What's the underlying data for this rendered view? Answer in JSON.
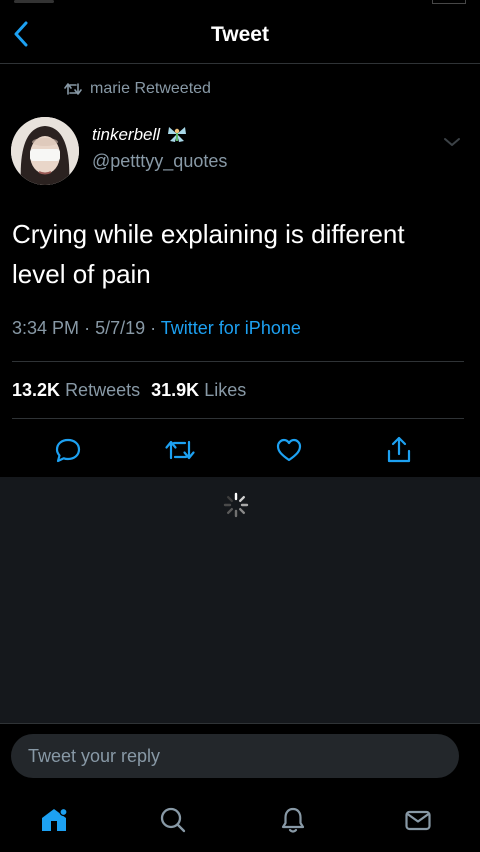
{
  "header": {
    "title": "Tweet",
    "back_icon": "chevron-left-icon"
  },
  "tweet": {
    "retweeted_by": "marie Retweeted",
    "display_name": "tinkerbell",
    "handle": "@petttyy_quotes",
    "text": "Crying while explaining is different level of pain",
    "time": "3:34 PM",
    "date": "5/7/19",
    "source": "Twitter for iPhone",
    "retweets_count": "13.2K",
    "retweets_label": "Retweets",
    "likes_count": "31.9K",
    "likes_label": "Likes"
  },
  "actions": [
    "reply-icon",
    "retweet-icon",
    "heart-icon",
    "share-icon"
  ],
  "reply": {
    "placeholder": "Tweet your reply"
  },
  "tabs": [
    "home-icon",
    "search-icon",
    "notifications-icon",
    "messages-icon"
  ],
  "colors": {
    "background": "#000000",
    "accent": "#1da1f2",
    "secondary_text": "#8899a6",
    "reply_panel": "#15181c"
  }
}
